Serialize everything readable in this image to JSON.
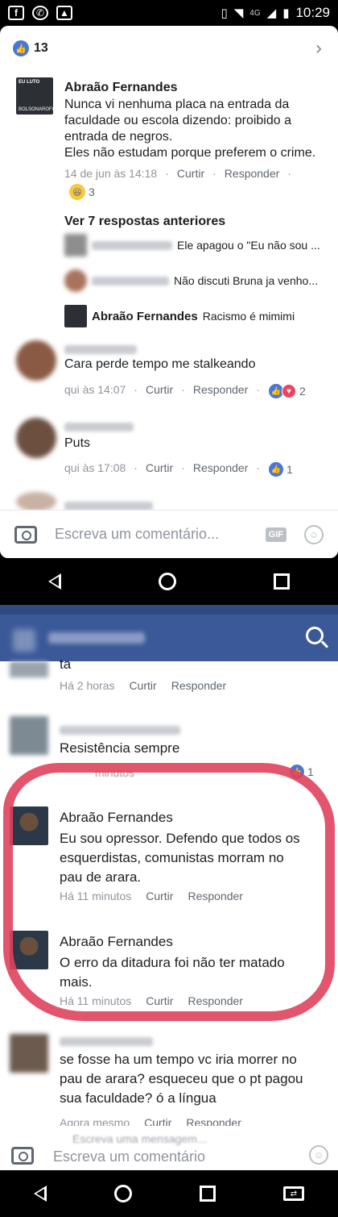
{
  "status_bar": {
    "time": "10:29",
    "network": "4G"
  },
  "top_post": {
    "like_count": "13",
    "main_comment": {
      "author": "Abraão Fernandes",
      "avatar_text": "EU LUTO BOLSONAROFOBIA",
      "text_lines": [
        "Nunca vi nenhuma placa na entrada da",
        "faculdade ou escola dizendo: proibido a",
        "entrada de negros.",
        "Eles não estudam porque preferem o crime."
      ],
      "date": "14 de jun às 14:18",
      "like_label": "Curtir",
      "reply_label": "Responder",
      "reaction_count": "3"
    },
    "view_previous": "Ver 7 respostas anteriores",
    "replies": [
      {
        "text": "Ele apagou o \"Eu não sou ..."
      },
      {
        "text": "Não discuti Bruna ja venho..."
      },
      {
        "author": "Abraão Fernandes",
        "text": "Racismo é mimimi"
      }
    ],
    "comments": [
      {
        "text": "Cara perde tempo me stalkeando",
        "time": "qui às 14:07",
        "like_label": "Curtir",
        "reply_label": "Responder",
        "reaction_count": "2"
      },
      {
        "text": "Puts",
        "time": "qui às 17:08",
        "like_label": "Curtir",
        "reply_label": "Responder",
        "reaction_count": "1"
      }
    ],
    "composer_placeholder": "Escreva um comentário...",
    "gif_label": "GIF"
  },
  "bottom_post": {
    "comments": [
      {
        "text": "ta",
        "time": "Há 2 horas",
        "like_label": "Curtir",
        "reply_label": "Responder"
      },
      {
        "text": "Resistência sempre",
        "time": "minutos",
        "reaction_count": "1"
      },
      {
        "author": "Abraão Fernandes",
        "text_lines": [
          "Eu sou opressor. Defendo que todos os",
          "esquerdistas, comunistas morram no",
          "pau de arara."
        ],
        "time": "Há 11 minutos",
        "like_label": "Curtir",
        "reply_label": "Responder"
      },
      {
        "author": "Abraão Fernandes",
        "text_lines": [
          "O erro da ditadura foi não ter matado",
          "mais."
        ],
        "time": "Há 11 minutos",
        "like_label": "Curtir",
        "reply_label": "Responder"
      },
      {
        "text_lines": [
          "se fosse ha um tempo vc iria morrer no",
          "pau de arara? esqueceu que o pt pagou",
          "sua faculdade? ó a língua"
        ],
        "time": "Agora mesmo",
        "like_label": "Curtir",
        "reply_label": "Responder"
      }
    ],
    "composer_hint": "Escreva uma mensagem...",
    "composer_placeholder": "Escreva um comentário"
  }
}
